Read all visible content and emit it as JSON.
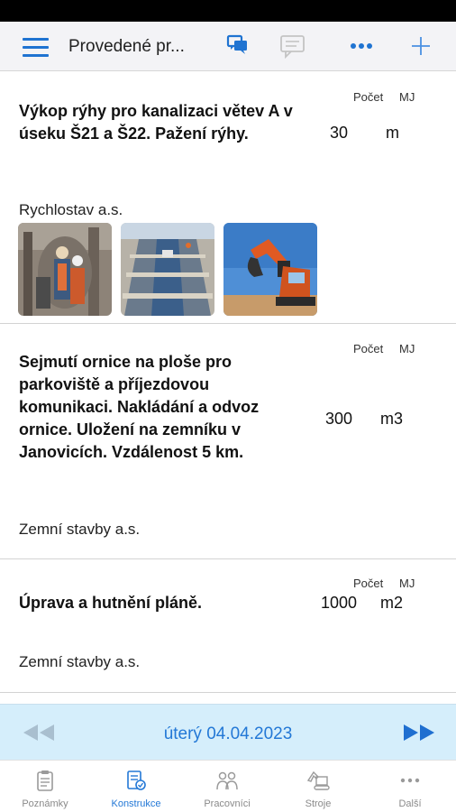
{
  "header": {
    "title": "Provedené pr..."
  },
  "records": [
    {
      "title": "Výkop rýhy pro kanalizaci větev A v úseku Š21 a Š22. Pažení rýhy.",
      "qty_label": "Počet",
      "unit_label": "MJ",
      "qty": "30",
      "unit": "m",
      "company": "Rychlostav a.s.",
      "photos": [
        "workers-photo",
        "trench-photo",
        "excavator-photo"
      ]
    },
    {
      "title": "Sejmutí ornice na ploše pro parkoviště a příjezdovou komunikaci. Nakládání a odvoz ornice. Uložení na zemníku v Janovicích. Vzdálenost 5 km.",
      "qty_label": "Počet",
      "unit_label": "MJ",
      "qty": "300",
      "unit": "m3",
      "company": "Zemní stavby a.s."
    },
    {
      "title": "Úprava a hutnění pláně.",
      "qty_label": "Počet",
      "unit_label": "MJ",
      "qty": "1000",
      "unit": "m2",
      "company": "Zemní stavby a.s."
    }
  ],
  "date_nav": {
    "date": "úterý 04.04.2023"
  },
  "tabs": [
    {
      "label": "Poznámky",
      "icon": "clipboard-icon"
    },
    {
      "label": "Konstrukce",
      "icon": "construction-doc-icon"
    },
    {
      "label": "Pracovníci",
      "icon": "workers-icon"
    },
    {
      "label": "Stroje",
      "icon": "excavator-icon"
    },
    {
      "label": "Další",
      "icon": "more-icon"
    }
  ],
  "colors": {
    "accent": "#2378d6",
    "date_bar": "#d5eefb",
    "nav_bg": "#f3f3f6"
  }
}
